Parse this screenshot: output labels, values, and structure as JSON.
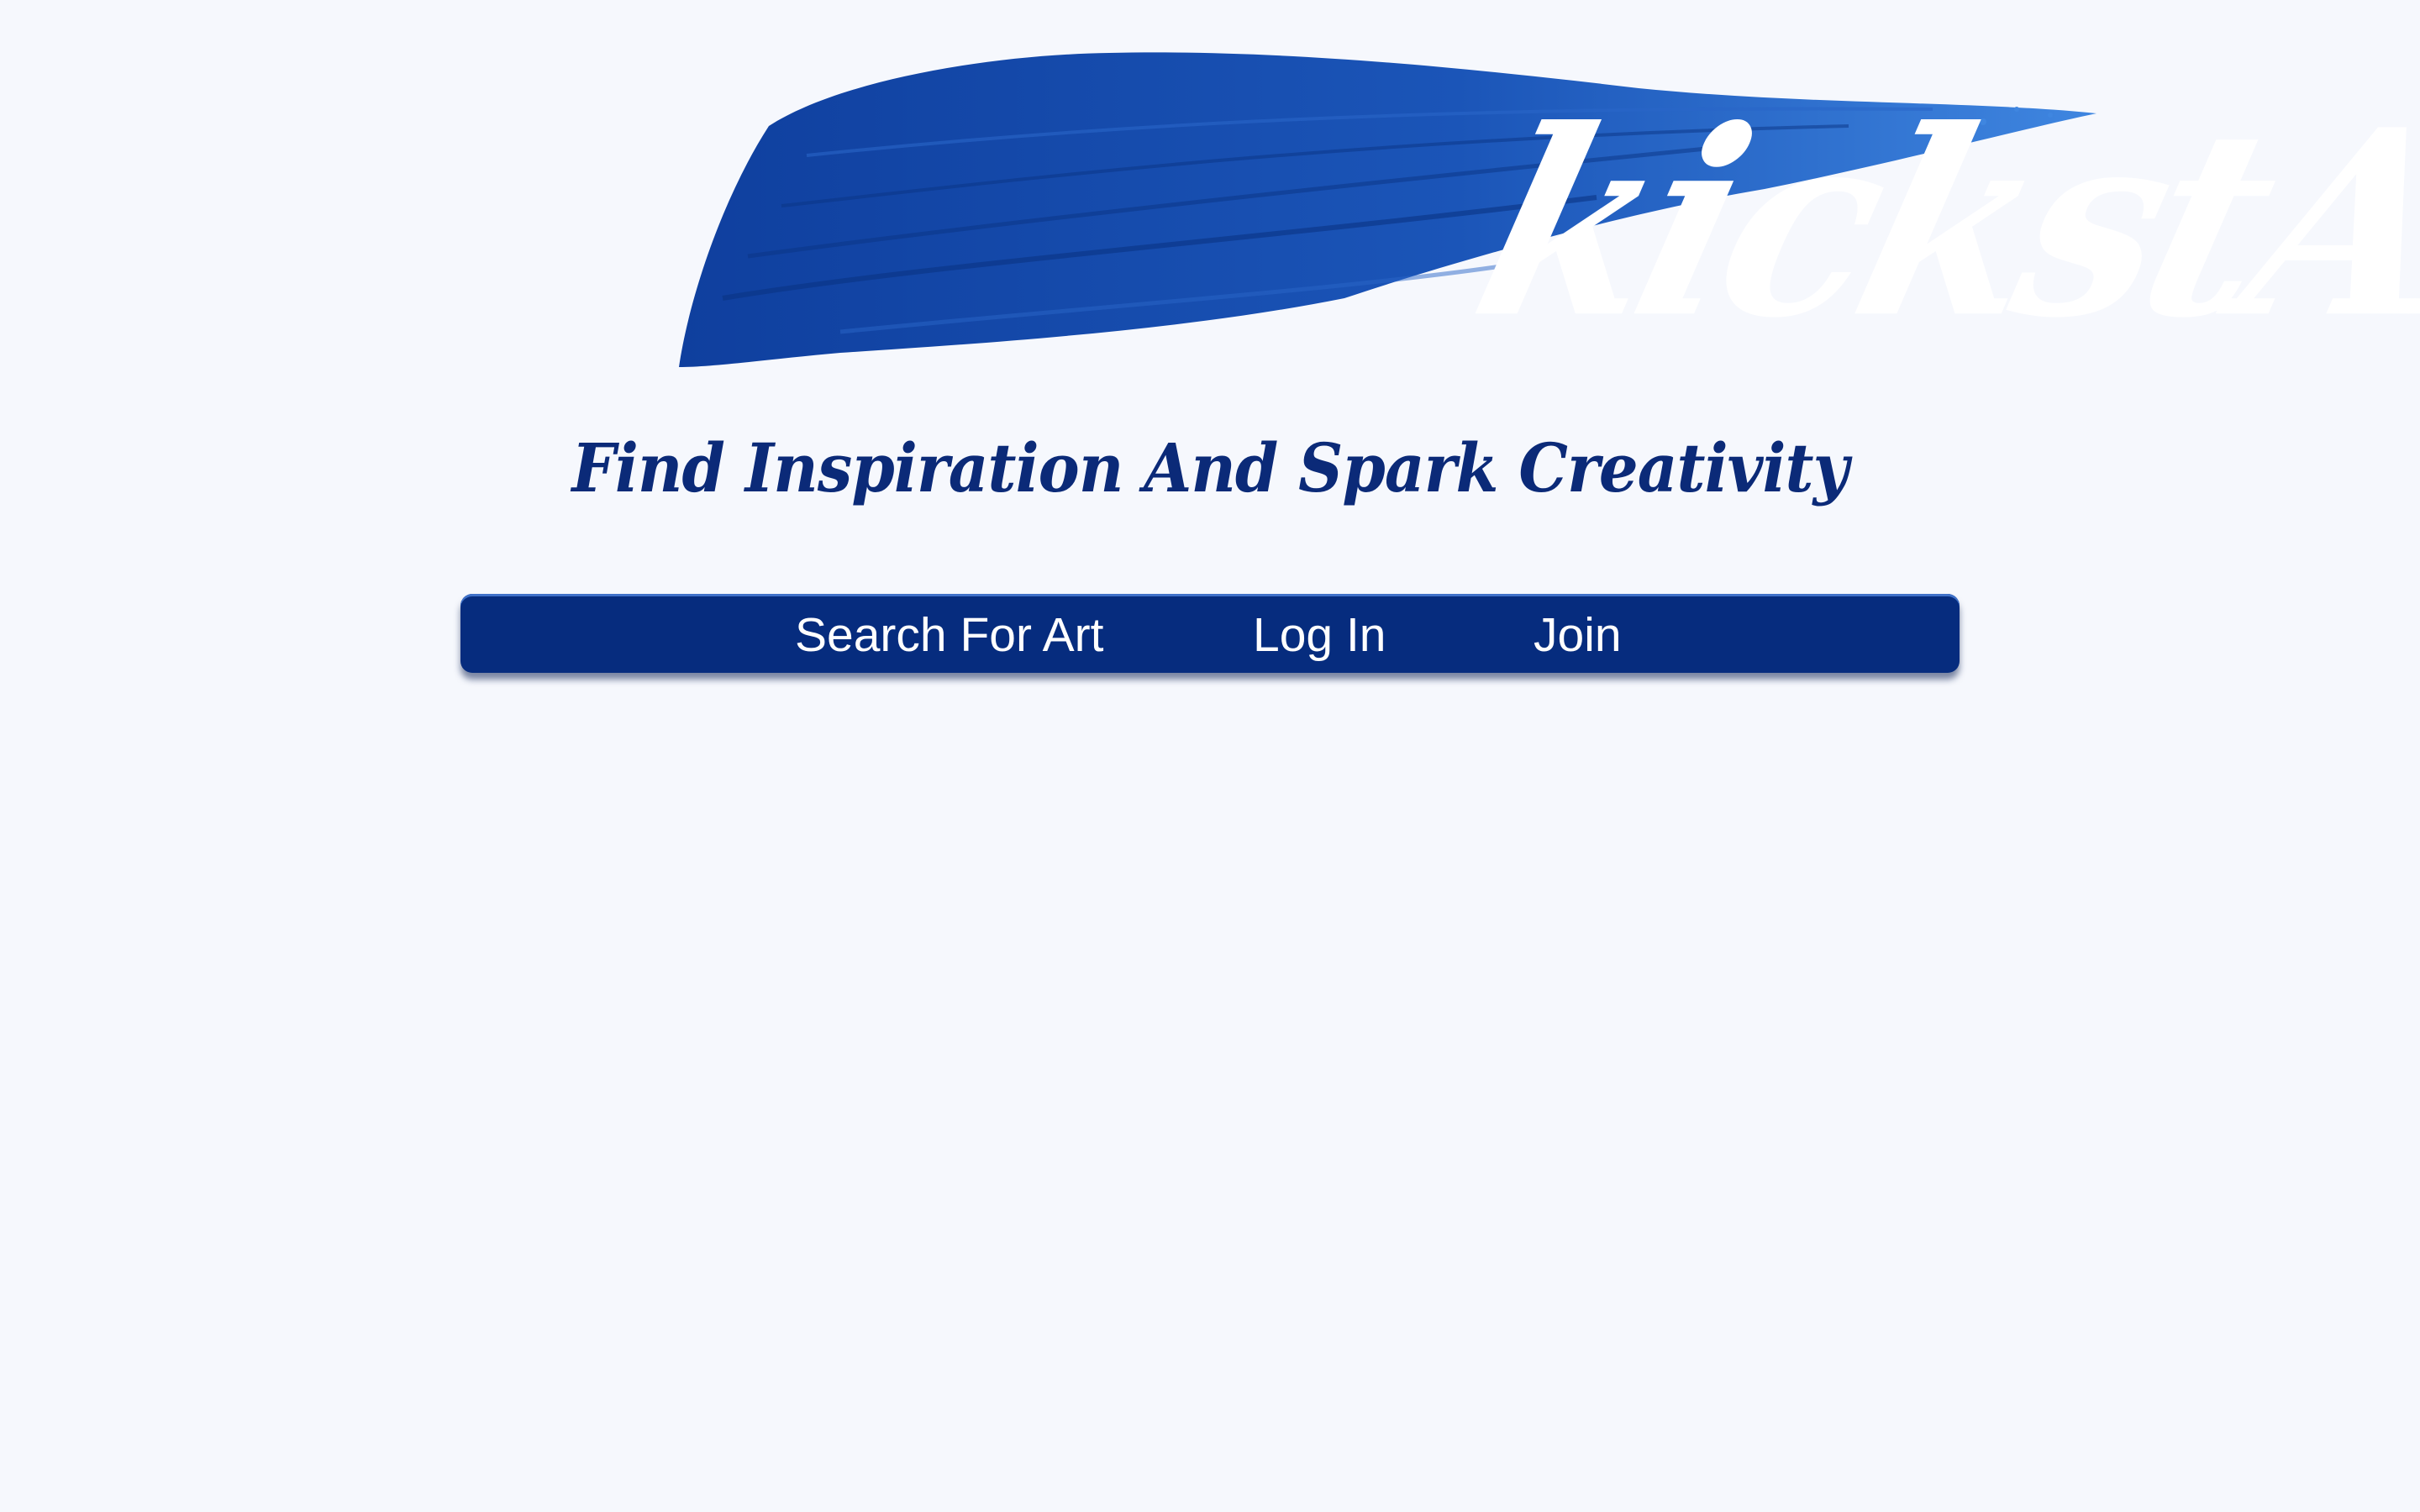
{
  "header": {
    "logo_text": "kickstART",
    "tagline": "Find Inspiration And Spark Creativity"
  },
  "nav": {
    "items": [
      {
        "label": "Search For Art"
      },
      {
        "label": "Log In"
      },
      {
        "label": "Join"
      }
    ]
  },
  "colors": {
    "background": "#f6f8fd",
    "brand_blue": "#062c7e",
    "brush_blue": "#1a4fb0",
    "tagline": "#0b2a78"
  }
}
